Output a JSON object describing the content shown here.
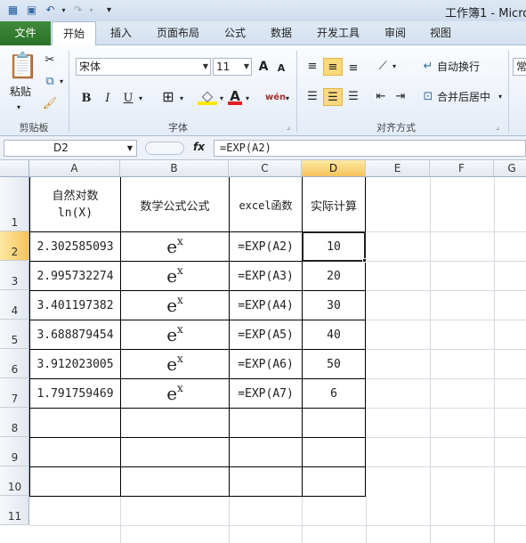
{
  "window": {
    "title": "工作簿1 - Micro"
  },
  "ribbon": {
    "tabs": [
      {
        "label": "文件"
      },
      {
        "label": "开始"
      },
      {
        "label": "插入"
      },
      {
        "label": "页面布局"
      },
      {
        "label": "公式"
      },
      {
        "label": "数据"
      },
      {
        "label": "开发工具"
      },
      {
        "label": "审阅"
      },
      {
        "label": "视图"
      }
    ],
    "clipboard": {
      "paste_label": "粘贴",
      "group_label": "剪贴板"
    },
    "font": {
      "name": "宋体",
      "size": "11",
      "group_label": "字体",
      "bold": "B",
      "italic": "I",
      "underline": "U",
      "grow": "A",
      "shrink": "A",
      "font_color": "A"
    },
    "alignment": {
      "wrap_label": "自动换行",
      "merge_label": "合并后居中",
      "group_label": "对齐方式"
    },
    "number": {
      "format_partial": "常"
    }
  },
  "formula_bar": {
    "name_box": "D2",
    "fx": "fx",
    "formula": "=EXP(A2)"
  },
  "colors": {
    "accent_file_tab": "#2b7228",
    "selection": "#f6c35b"
  },
  "grid": {
    "columns": [
      "A",
      "B",
      "C",
      "D",
      "E",
      "F",
      "G"
    ],
    "rows": [
      "1",
      "2",
      "3",
      "4",
      "5",
      "6",
      "7",
      "8",
      "9",
      "10",
      "11"
    ],
    "selected_cell": "D2",
    "headers": {
      "a1_line1": "自然对数",
      "a1_line2": "ln(X)",
      "b1": "数学公式公式",
      "c1": "excel函数",
      "d1": "实际计算"
    },
    "data_rows": [
      {
        "a": "2.302585093",
        "b_base": "e",
        "b_sup": "x",
        "c": "=EXP(A2)",
        "d": "10"
      },
      {
        "a": "2.995732274",
        "b_base": "e",
        "b_sup": "x",
        "c": "=EXP(A3)",
        "d": "20"
      },
      {
        "a": "3.401197382",
        "b_base": "e",
        "b_sup": "x",
        "c": "=EXP(A4)",
        "d": "30"
      },
      {
        "a": "3.688879454",
        "b_base": "e",
        "b_sup": "x",
        "c": "=EXP(A5)",
        "d": "40"
      },
      {
        "a": "3.912023005",
        "b_base": "e",
        "b_sup": "x",
        "c": "=EXP(A6)",
        "d": "50"
      },
      {
        "a": "1.791759469",
        "b_base": "e",
        "b_sup": "x",
        "c": "=EXP(A7)",
        "d": "6"
      }
    ]
  }
}
